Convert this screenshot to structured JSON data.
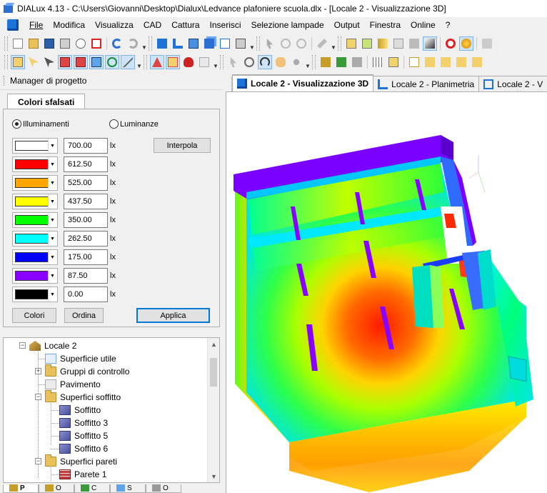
{
  "window": {
    "title": "DIALux 4.13 - C:\\Users\\Giovanni\\Desktop\\Dialux\\Ledvance plafoniere scuola.dlx - [Locale 2 - Visualizzazione 3D]"
  },
  "menu": {
    "items": [
      "File",
      "Modifica",
      "Visualizza",
      "CAD",
      "Cattura",
      "Inserisci",
      "Selezione lampade",
      "Output",
      "Finestra",
      "Online",
      "?"
    ]
  },
  "toolbar1": {
    "icons": [
      "new-file-icon",
      "open-folder-icon",
      "save-icon",
      "print-icon",
      "print-preview-icon",
      "pdf-icon",
      "undo-icon",
      "redo-icon",
      "cube-icon",
      "room-l-icon",
      "room-cube-icon",
      "box-stack-icon",
      "copy-view-icon",
      "pointer-icon",
      "rotate-icon",
      "rotate2-icon",
      "wrench-icon",
      "object-icon",
      "object2-icon",
      "luminaire-icon",
      "texture-icon",
      "material-icon",
      "light-icon",
      "eye-icon",
      "render-icon",
      "arrow-pencil-icon",
      "more-icon"
    ]
  },
  "toolbar2": {
    "icons": [
      "select-icon",
      "select2-icon",
      "select3-icon",
      "move-icon",
      "rotate-obj-icon",
      "snap-icon",
      "zoom-icon",
      "measure-icon",
      "calc-icon",
      "warning-icon",
      "flame-icon",
      "dxf-icon",
      "pointer2-icon",
      "magnifier-icon",
      "orbit-icon",
      "hand-icon",
      "walk-icon",
      "box-icon",
      "tag-icon",
      "leaf-icon",
      "render2-icon",
      "camera-icon",
      "view-icon",
      "view2-icon",
      "view3-icon",
      "view4-icon",
      "view5-icon"
    ]
  },
  "left": {
    "header": "Manager di progetto",
    "tab": "Colori sfalsati",
    "radio_illum": "Illuminamenti",
    "radio_lum": "Luminanze",
    "interpola": "Interpola",
    "unit": "lx",
    "levels": [
      {
        "color": "#ffffff",
        "value": "700.00"
      },
      {
        "color": "#ff0000",
        "value": "612.50"
      },
      {
        "color": "#ffa500",
        "value": "525.00"
      },
      {
        "color": "#ffff00",
        "value": "437.50"
      },
      {
        "color": "#00ff00",
        "value": "350.00"
      },
      {
        "color": "#00ffff",
        "value": "262.50"
      },
      {
        "color": "#0000ff",
        "value": "175.00"
      },
      {
        "color": "#8a00ff",
        "value": "87.50"
      },
      {
        "color": "#000000",
        "value": "0.00"
      }
    ],
    "btn_colori": "Colori",
    "btn_ordina": "Ordina",
    "btn_applica": "Applica"
  },
  "tree": {
    "items": [
      {
        "label": "Locale 2",
        "icon": "room-icon"
      },
      {
        "label": "Superficie utile",
        "icon": "surface-icon"
      },
      {
        "label": "Gruppi di controllo",
        "icon": "folder-icon"
      },
      {
        "label": "Pavimento",
        "icon": "floor-icon"
      },
      {
        "label": "Superfici soffitto",
        "icon": "folder-icon"
      },
      {
        "label": "Soffitto",
        "icon": "ceiling-icon"
      },
      {
        "label": "Soffitto 3",
        "icon": "ceiling-icon"
      },
      {
        "label": "Soffitto 5",
        "icon": "ceiling-icon"
      },
      {
        "label": "Soffitto 6",
        "icon": "ceiling-icon"
      },
      {
        "label": "Superfici pareti",
        "icon": "folder-icon"
      },
      {
        "label": "Parete 1",
        "icon": "wall-icon"
      }
    ]
  },
  "bottom_tabs": [
    "P",
    "O",
    "C",
    "S",
    "O"
  ],
  "doc_tabs": [
    "Locale 2 - Visualizzazione 3D",
    "Locale 2 - Planimetria",
    "Locale 2 - V"
  ]
}
